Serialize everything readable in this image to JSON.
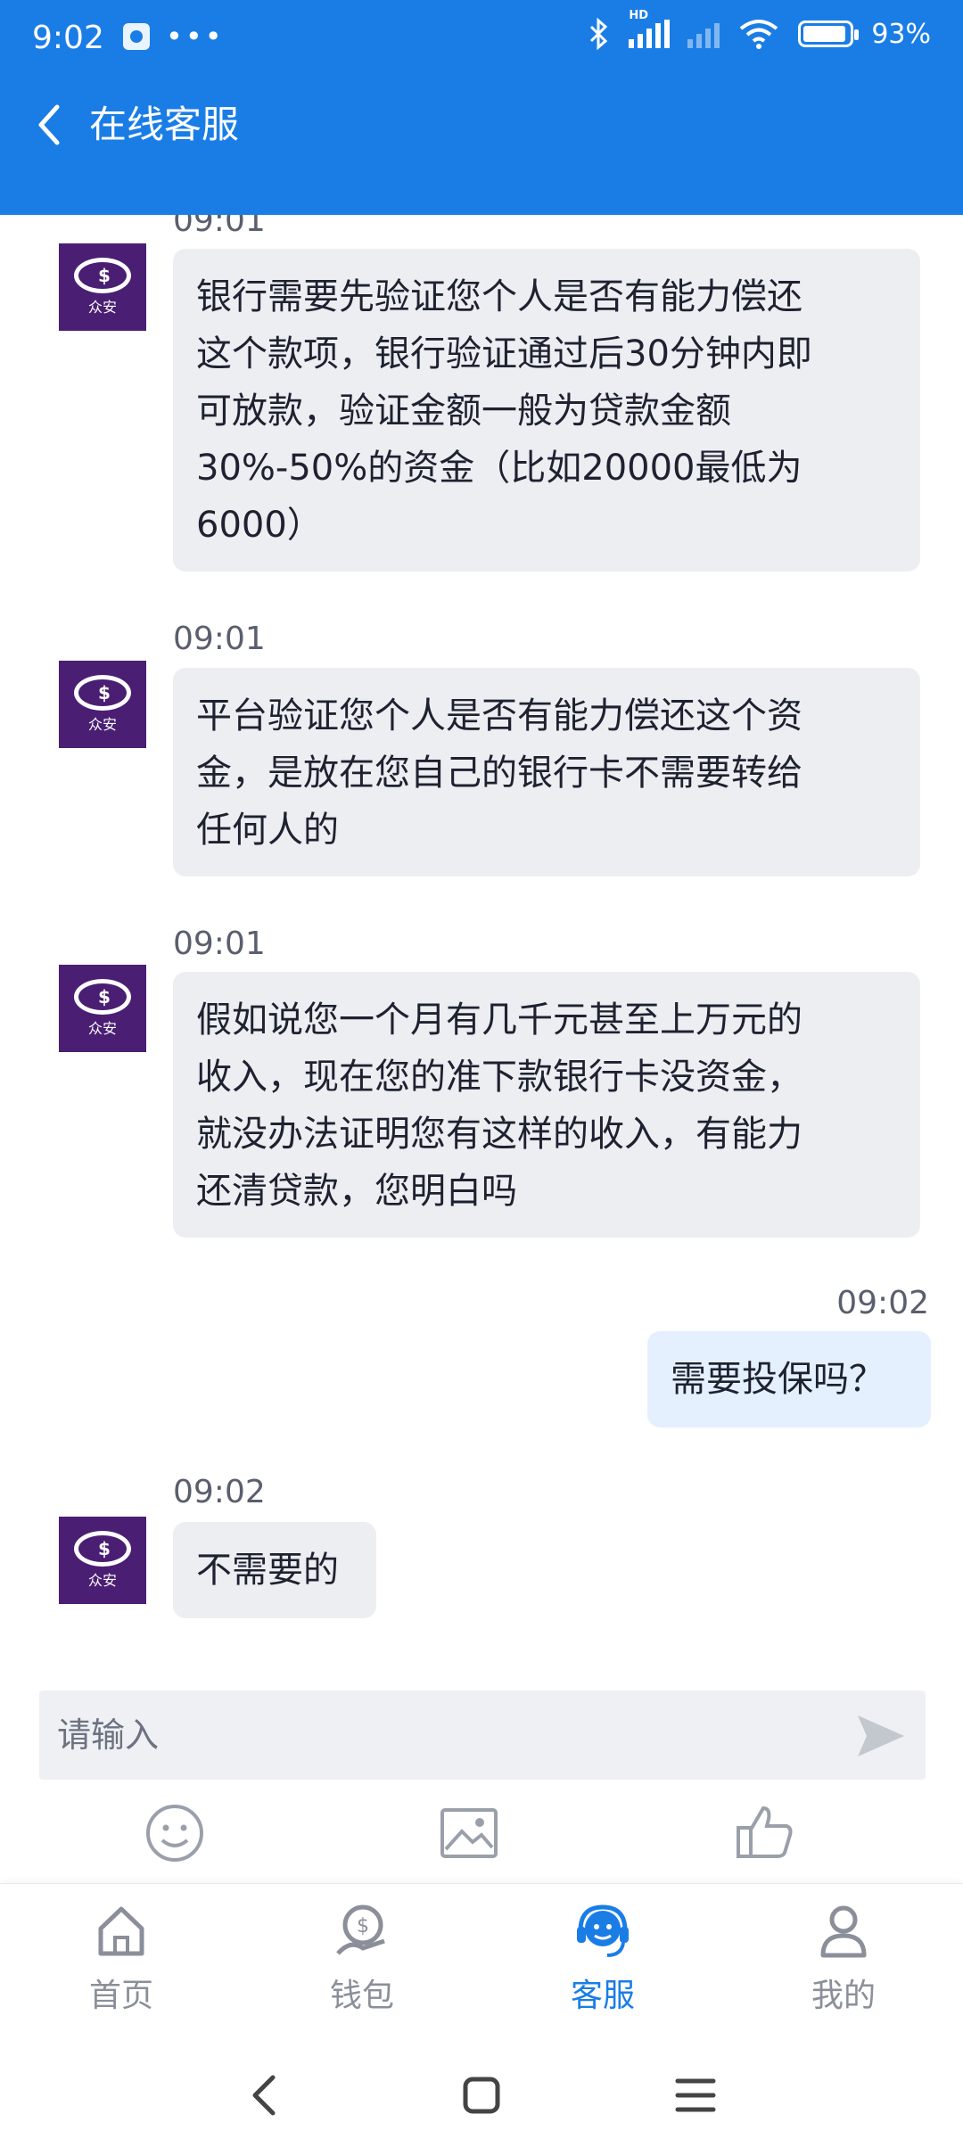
{
  "status_bar": {
    "time": "9:02",
    "battery": "93%",
    "signal_label": "HD"
  },
  "header": {
    "title": "在线客服"
  },
  "messages": [
    {
      "from": "agent",
      "time": "09:01",
      "text": [
        "银行需要先验证您个人是否有能力偿还",
        "这个款项，银行验证通过后30分钟内即",
        "可放款，验证金额一般为贷款金额",
        "30%-50%的资金（比如20000最低为",
        "6000）"
      ]
    },
    {
      "from": "agent",
      "time": "09:01",
      "text": [
        "平台验证您个人是否有能力偿还这个资",
        "金，是放在您自己的银行卡不需要转给",
        "任何人的"
      ]
    },
    {
      "from": "agent",
      "time": "09:01",
      "text": [
        "假如说您一个月有几千元甚至上万元的",
        "收入，现在您的准下款银行卡没资金，",
        "就没办法证明您有这样的收入，有能力",
        "还清贷款，您明白吗"
      ]
    },
    {
      "from": "me",
      "time": "09:02",
      "text": [
        "需要投保吗？"
      ]
    },
    {
      "from": "agent",
      "time": "09:02",
      "text": [
        "不需要的"
      ]
    }
  ],
  "avatar": {
    "brand_text": "众安"
  },
  "input": {
    "placeholder": "请输入"
  },
  "tools": [
    "emoji-icon",
    "image-icon",
    "thumbs-up-icon"
  ],
  "tabs": [
    {
      "label": "首页",
      "icon": "home-icon",
      "active": false
    },
    {
      "label": "钱包",
      "icon": "wallet-icon",
      "active": false
    },
    {
      "label": "客服",
      "icon": "headset-icon",
      "active": true
    },
    {
      "label": "我的",
      "icon": "user-icon",
      "active": false
    }
  ],
  "colors": {
    "accent": "#1a7de6",
    "bubble_agent": "#eceef2",
    "bubble_me": "#e4f0fd"
  }
}
